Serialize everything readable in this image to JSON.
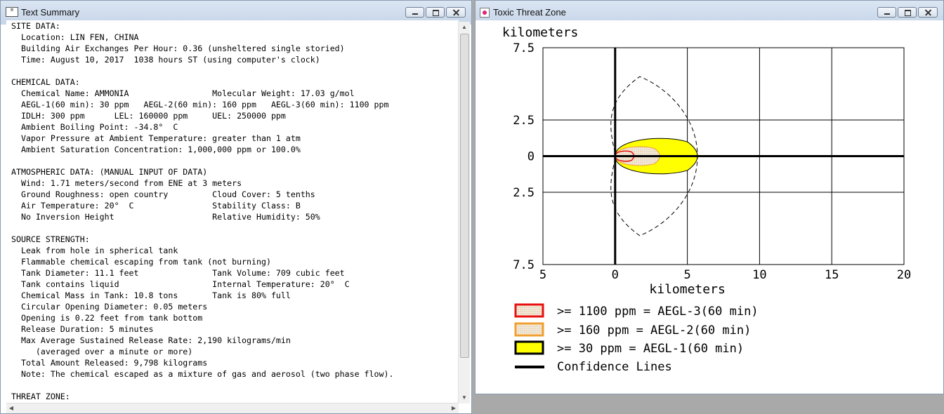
{
  "text_window": {
    "title": "Text Summary",
    "summary_text": "SITE DATA:\n  Location: LIN FEN, CHINA\n  Building Air Exchanges Per Hour: 0.36 (unsheltered single storied)\n  Time: August 10, 2017  1038 hours ST (using computer's clock)\n\nCHEMICAL DATA:\n  Chemical Name: AMMONIA                 Molecular Weight: 17.03 g/mol\n  AEGL-1(60 min): 30 ppm   AEGL-2(60 min): 160 ppm   AEGL-3(60 min): 1100 ppm\n  IDLH: 300 ppm      LEL: 160000 ppm     UEL: 250000 ppm\n  Ambient Boiling Point: -34.8°  C\n  Vapor Pressure at Ambient Temperature: greater than 1 atm\n  Ambient Saturation Concentration: 1,000,000 ppm or 100.0%\n\nATMOSPHERIC DATA: (MANUAL INPUT OF DATA)\n  Wind: 1.71 meters/second from ENE at 3 meters\n  Ground Roughness: open country         Cloud Cover: 5 tenths\n  Air Temperature: 20°  C                Stability Class: B\n  No Inversion Height                    Relative Humidity: 50%\n\nSOURCE STRENGTH:\n  Leak from hole in spherical tank\n  Flammable chemical escaping from tank (not burning)\n  Tank Diameter: 11.1 feet               Tank Volume: 709 cubic feet\n  Tank contains liquid                   Internal Temperature: 20°  C\n  Chemical Mass in Tank: 10.8 tons       Tank is 80% full\n  Circular Opening Diameter: 0.05 meters\n  Opening is 0.22 feet from tank bottom\n  Release Duration: 5 minutes\n  Max Average Sustained Release Rate: 2,190 kilograms/min\n     (averaged over a minute or more)\n  Total Amount Released: 9,798 kilograms\n  Note: The chemical escaped as a mixture of gas and aerosol (two phase flow).\n\nTHREAT ZONE:"
  },
  "plot_window": {
    "title": "Toxic Threat Zone",
    "y_axis_label": "kilometers",
    "x_axis_label": "kilometers",
    "y_tick_labels": [
      "7.5",
      "2.5",
      "0",
      "2.5",
      "7.5"
    ],
    "x_tick_labels": [
      "5",
      "0",
      "5",
      "10",
      "15",
      "20"
    ],
    "legend": [
      {
        "label": ">= 1100 ppm = AEGL-3(60 min)",
        "swatch_fill": "#f4ead8",
        "swatch_border": "#e81010"
      },
      {
        "label": ">= 160 ppm = AEGL-2(60 min)",
        "swatch_fill": "#f4ead8",
        "swatch_border": "#f0a030"
      },
      {
        "label": ">= 30 ppm = AEGL-1(60 min)",
        "swatch_fill": "#ffff00",
        "swatch_border": "#000000"
      },
      {
        "label": "Confidence Lines",
        "swatch_fill": "none",
        "swatch_border": "#000000"
      }
    ]
  },
  "colors": {
    "aegl1_fill": "#ffff00",
    "aegl2_fill": "#f4ead8",
    "aegl2_border": "#f0a030",
    "aegl3_border": "#e81010",
    "grid": "#000000"
  },
  "chart_data": {
    "type": "threat_zone_plot",
    "xlim": [
      -5,
      20
    ],
    "ylim": [
      -7.5,
      7.5
    ],
    "x_ticks": [
      -5,
      0,
      5,
      10,
      15,
      20
    ],
    "y_ticks": [
      7.5,
      2.5,
      0,
      -2.5,
      -7.5
    ],
    "grid": true,
    "zones": [
      {
        "name": ">= 1100 ppm = AEGL-3(60 min)",
        "downwind_extent_km": 1.3,
        "max_halfwidth_km": 0.4
      },
      {
        "name": ">= 160 ppm = AEGL-2(60 min)",
        "downwind_extent_km": 3.1,
        "max_halfwidth_km": 0.75
      },
      {
        "name": ">= 30 ppm = AEGL-1(60 min)",
        "downwind_extent_km": 5.7,
        "max_halfwidth_km": 1.4
      }
    ],
    "confidence_lines": {
      "downwind_extent_km": 5.7,
      "max_halfwidth_km": 5.5
    }
  }
}
